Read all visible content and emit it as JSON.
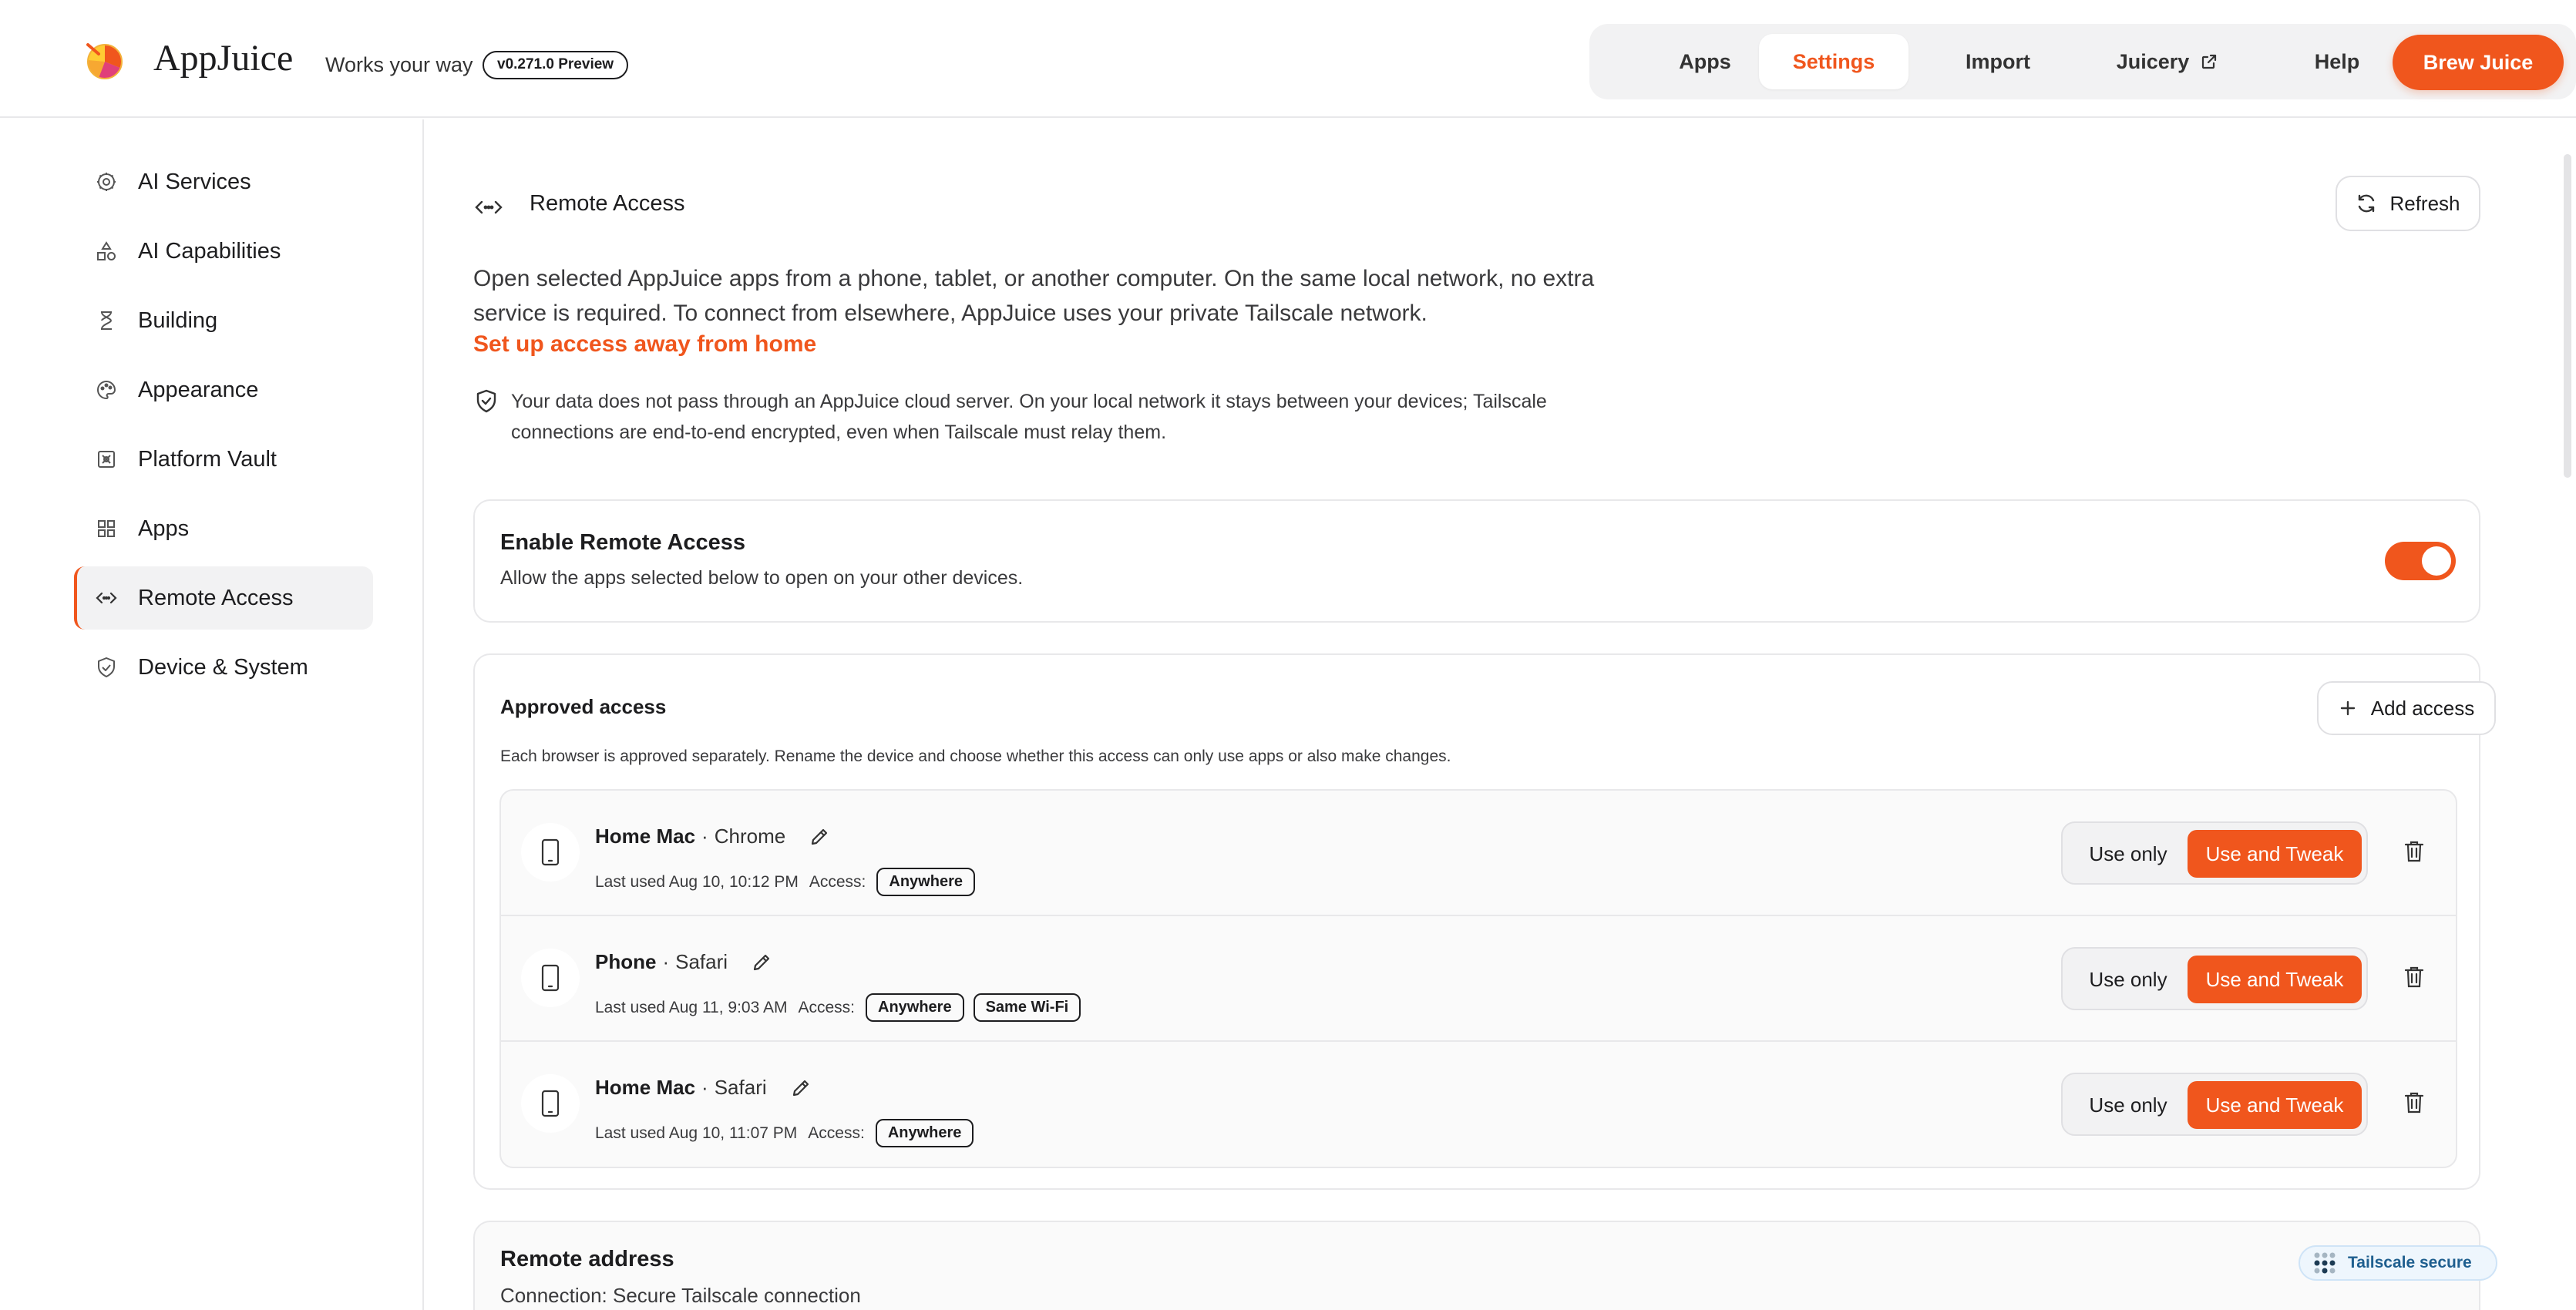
{
  "header": {
    "brand": "AppJuice",
    "tagline": "Works your way",
    "version": "v0.271.0 Preview",
    "nav": [
      {
        "label": "Apps"
      },
      {
        "label": "Settings"
      },
      {
        "label": "Import"
      },
      {
        "label": "Juicery"
      },
      {
        "label": "Help"
      }
    ],
    "primary_button": "Brew Juice",
    "accent_color": "#f0561d"
  },
  "sidebar": {
    "items": [
      {
        "label": "AI Services",
        "icon": "gear-icon"
      },
      {
        "label": "AI Capabilities",
        "icon": "shapes-icon"
      },
      {
        "label": "Building",
        "icon": "hourglass-icon"
      },
      {
        "label": "Appearance",
        "icon": "palette-icon"
      },
      {
        "label": "Platform Vault",
        "icon": "vault-icon"
      },
      {
        "label": "Apps",
        "icon": "grid-icon"
      },
      {
        "label": "Remote Access",
        "icon": "code-icon"
      },
      {
        "label": "Device & System",
        "icon": "shield-icon"
      }
    ],
    "active": "Remote Access"
  },
  "main": {
    "title": "Remote Access",
    "refresh_label": "Refresh",
    "intro_line1": "Open selected AppJuice apps from a phone, tablet, or another computer. On the same local network, no extra",
    "intro_line2": "service is required. To connect from elsewhere, AppJuice uses your private Tailscale network.",
    "setup_link": "Set up access away from home",
    "privacy_line1": "Your data does not pass through an AppJuice cloud server. On your local network it stays between your devices; Tailscale",
    "privacy_line2": "connections are end-to-end encrypted, even when Tailscale must relay them.",
    "enable": {
      "title": "Enable Remote Access",
      "subtitle": "Allow the apps selected below to open on your other devices.",
      "enabled": true
    },
    "approved": {
      "title": "Approved access",
      "add_label": "Add access",
      "note": "Each browser is approved separately. Rename the device and choose whether this access can only use apps or also make changes.",
      "access_label": "Access:",
      "option_use_only": "Use only",
      "option_use_tweak": "Use and Tweak",
      "devices": [
        {
          "name": "Home Mac",
          "browser": "Chrome",
          "last_used": "Last used Aug 10, 10:12 PM",
          "scopes": [
            "Anywhere"
          ],
          "mode": "Use and Tweak"
        },
        {
          "name": "Phone",
          "browser": "Safari",
          "last_used": "Last used Aug 11, 9:03 AM",
          "scopes": [
            "Anywhere",
            "Same Wi-Fi"
          ],
          "mode": "Use and Tweak"
        },
        {
          "name": "Home Mac",
          "browser": "Safari",
          "last_used": "Last used Aug 10, 11:07 PM",
          "scopes": [
            "Anywhere"
          ],
          "mode": "Use and Tweak"
        }
      ]
    },
    "remote": {
      "title": "Remote address",
      "connection": "Connection: Secure Tailscale connection",
      "badge": "Tailscale secure"
    }
  }
}
